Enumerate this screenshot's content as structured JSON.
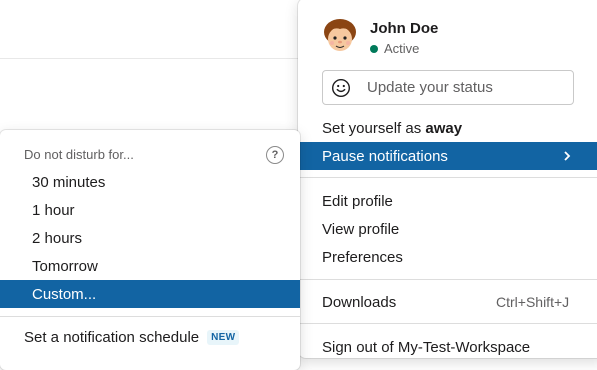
{
  "profile": {
    "name": "John Doe",
    "presence": "Active",
    "presence_color": "#007a5a",
    "status_placeholder": "Update your status"
  },
  "menu": {
    "set_away_prefix": "Set yourself as ",
    "set_away_bold": "away",
    "pause_notifications": "Pause notifications",
    "edit_profile": "Edit profile",
    "view_profile": "View profile",
    "preferences": "Preferences",
    "downloads": "Downloads",
    "downloads_shortcut": "Ctrl+Shift+J",
    "sign_out": "Sign out of My-Test-Workspace"
  },
  "dnd": {
    "header": "Do not disturb for...",
    "help_icon": "?",
    "options": [
      "30 minutes",
      "1 hour",
      "2 hours",
      "Tomorrow",
      "Custom..."
    ],
    "schedule": "Set a notification schedule",
    "new_badge": "NEW"
  },
  "colors": {
    "selection": "#1264a3"
  }
}
